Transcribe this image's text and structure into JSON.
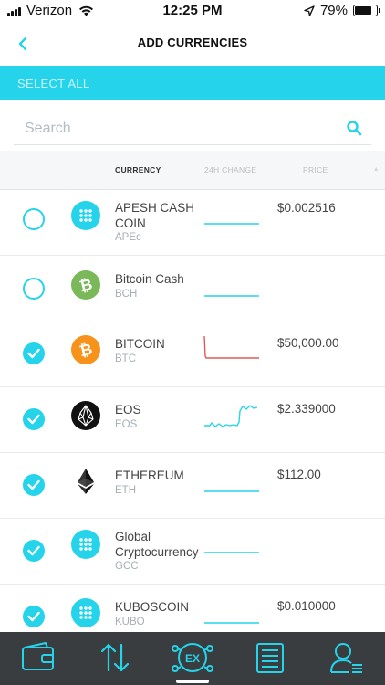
{
  "status_bar": {
    "carrier": "Verizon",
    "time": "12:25 PM",
    "battery": "79%"
  },
  "nav": {
    "title": "ADD CURRENCIES"
  },
  "select_all": {
    "label": "SELECT ALL"
  },
  "search": {
    "placeholder": "Search"
  },
  "table_header": {
    "currency": "CURRENCY",
    "change": "24H CHANGE",
    "price": "PRICE"
  },
  "currencies": [
    {
      "name": "APESH CASH COIN",
      "symbol": "APEc",
      "price": "$0.002516",
      "selected": false,
      "icon": "dots-coin-icon"
    },
    {
      "name": "Bitcoin Cash",
      "symbol": "BCH",
      "price": "",
      "selected": false,
      "icon": "bitcoin-cash-icon"
    },
    {
      "name": "BITCOIN",
      "symbol": "BTC",
      "price": "$50,000.00",
      "selected": true,
      "icon": "bitcoin-icon"
    },
    {
      "name": "EOS",
      "symbol": "EOS",
      "price": "$2.339000",
      "selected": true,
      "icon": "eos-icon"
    },
    {
      "name": "ETHEREUM",
      "symbol": "ETH",
      "price": "$112.00",
      "selected": true,
      "icon": "ethereum-icon"
    },
    {
      "name": "Global Cryptocurrency",
      "symbol": "GCC",
      "price": "",
      "selected": true,
      "icon": "dots-coin-icon"
    },
    {
      "name": "KUBOSCOIN",
      "symbol": "KUBO",
      "price": "$0.010000",
      "selected": true,
      "icon": "dots-coin-icon"
    }
  ],
  "tab_bar": {
    "tabs": [
      "wallet-icon",
      "transfer-arrows-icon",
      "exchange-icon",
      "list-icon",
      "profile-icon"
    ],
    "active": "exchange-icon"
  },
  "colors": {
    "accent": "#25d4ea",
    "tab_bar": "#3a3d40",
    "negative": "#e05a5a",
    "bitcoin": "#f7931a",
    "bitcoin_cash": "#7ab85a"
  }
}
